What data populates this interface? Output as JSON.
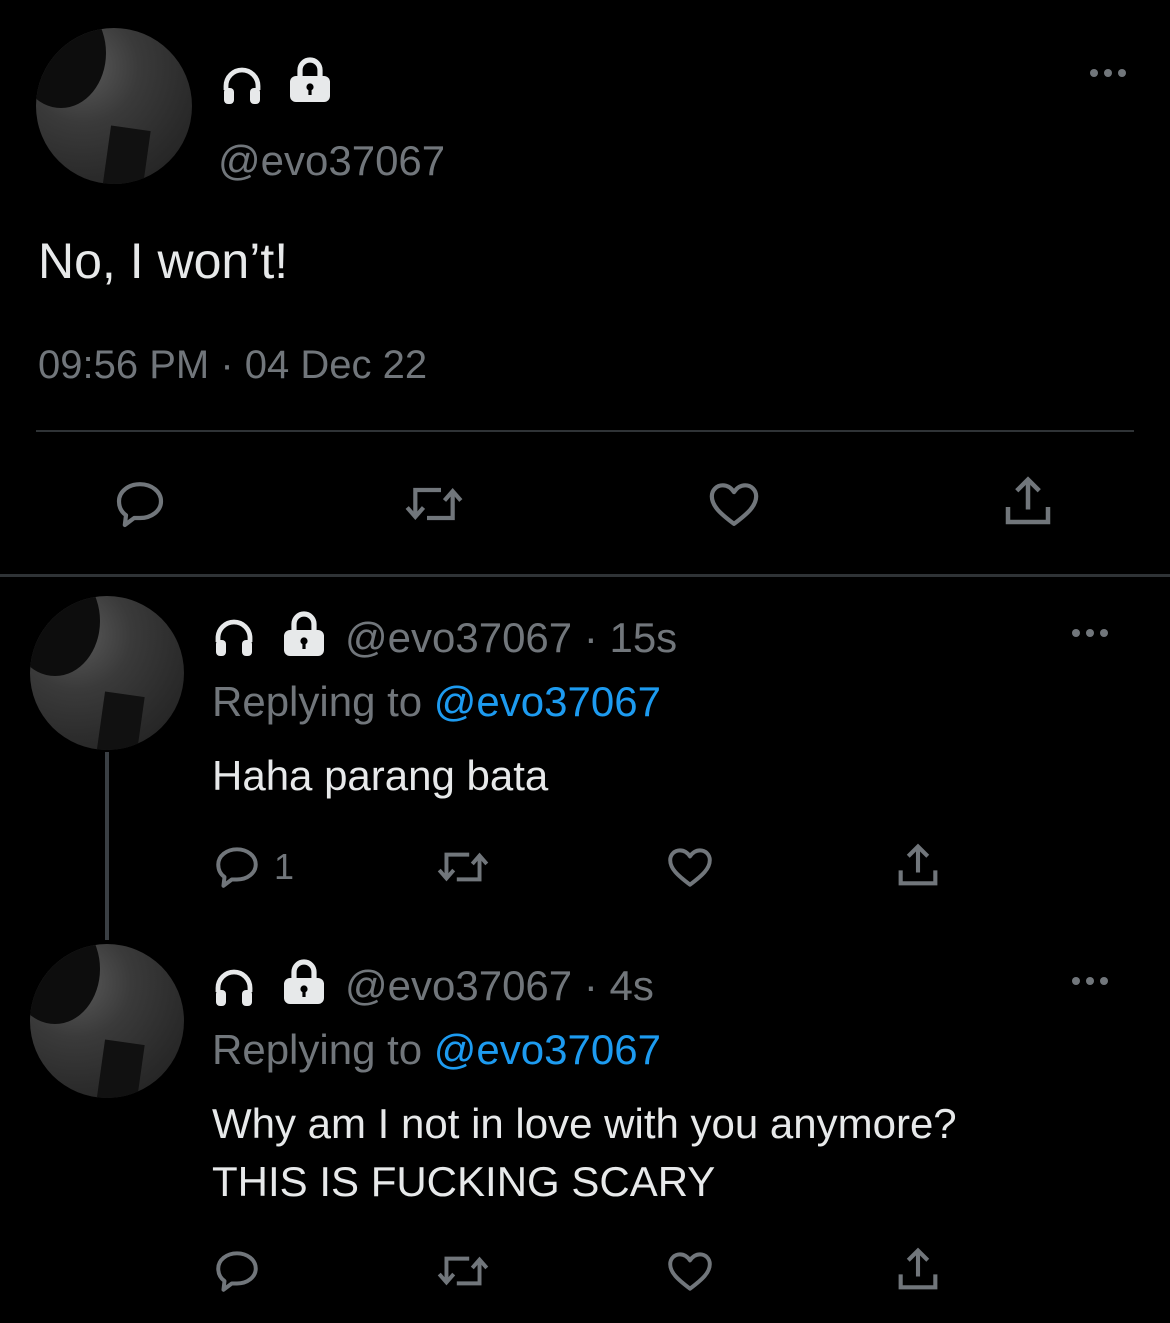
{
  "main_tweet": {
    "handle": "@evo37067",
    "text": "No, I won’t!",
    "timestamp": "09:56 PM · 04 Dec 22",
    "icons": [
      "headphones-icon",
      "lock-icon"
    ]
  },
  "replies": [
    {
      "handle_time": "@evo37067 · 15s",
      "replying_prefix": "Replying to",
      "replying_handle": "@evo37067",
      "text_line1": "Haha parang bata",
      "reply_count": "1"
    },
    {
      "handle_time": "@evo37067 · 4s",
      "replying_prefix": "Replying to",
      "replying_handle": "@evo37067",
      "text_line1": "Why am I not in love with you anymore?",
      "text_line2": "THIS IS FUCKING SCARY"
    }
  ],
  "colors": {
    "background": "#000000",
    "text": "#e7e9ea",
    "secondary": "#71767b",
    "accent": "#1d9bf0",
    "divider": "#2f3336"
  }
}
